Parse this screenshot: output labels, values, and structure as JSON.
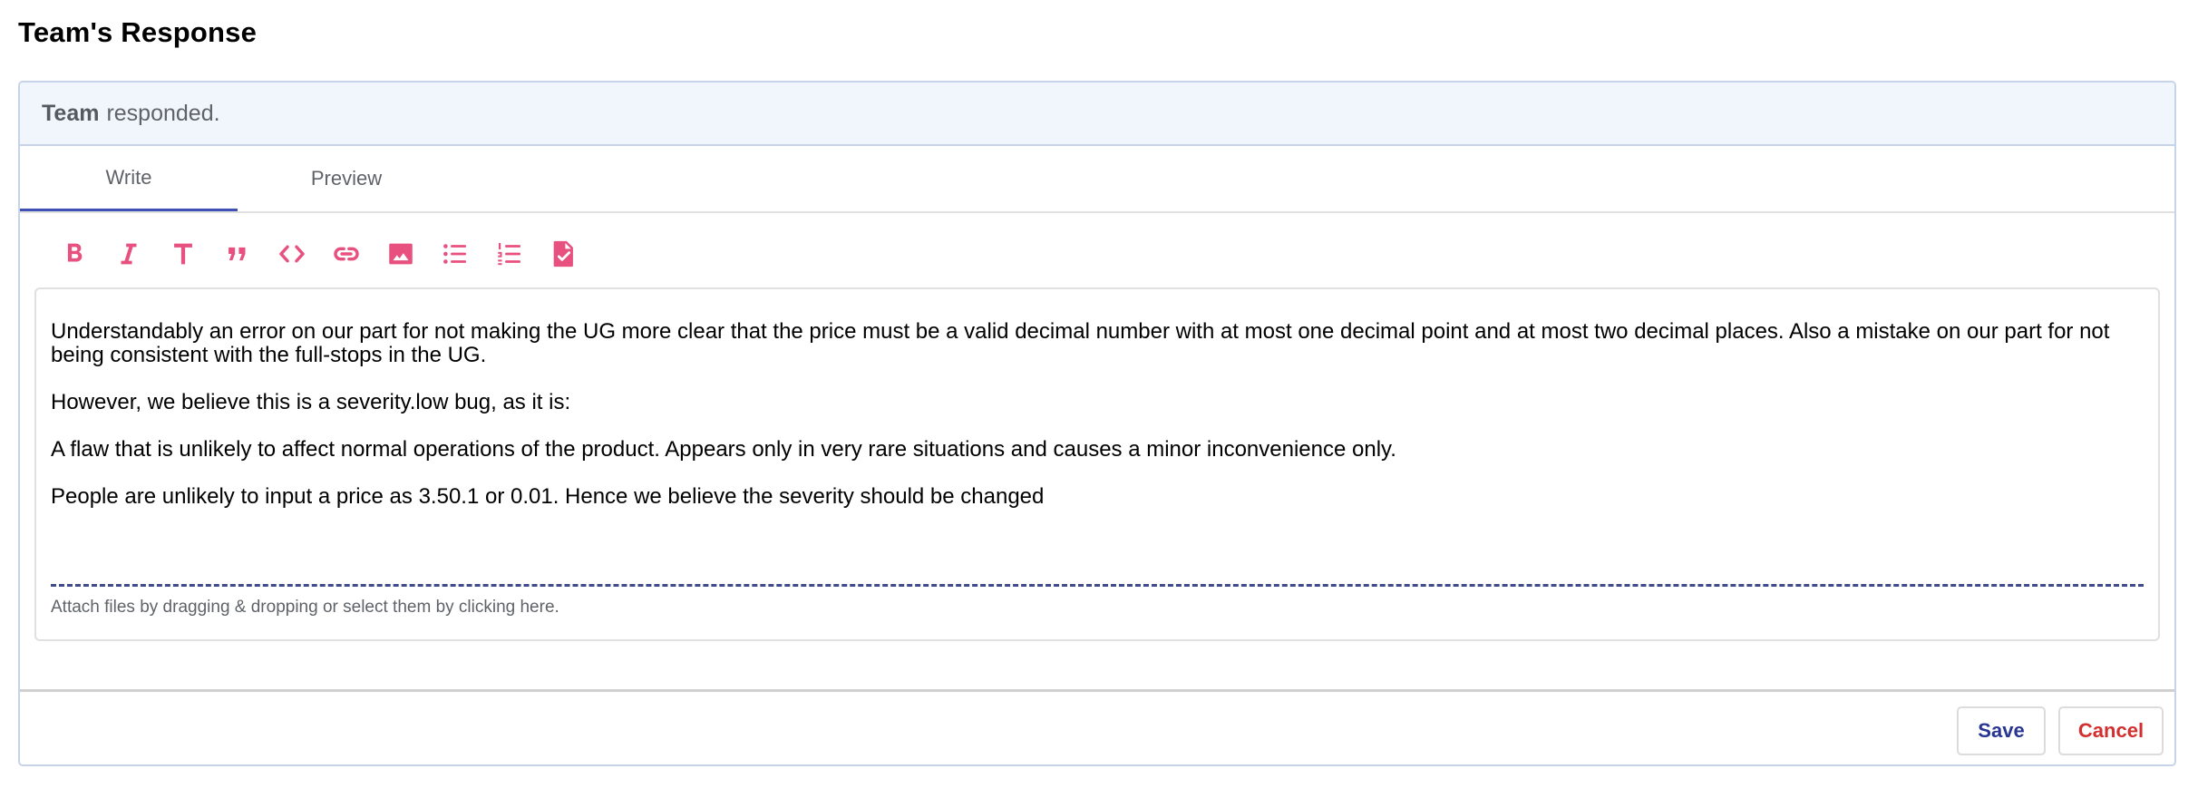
{
  "page": {
    "title": "Team's Response"
  },
  "comment": {
    "author": "Team",
    "action": "responded."
  },
  "tabs": [
    {
      "label": "Write",
      "active": true
    },
    {
      "label": "Preview",
      "active": false
    }
  ],
  "toolbar": {
    "icon_color": "#e8507f",
    "tools": [
      "bold-icon",
      "italic-icon",
      "heading-icon",
      "quote-icon",
      "code-icon",
      "link-icon",
      "image-icon",
      "bulleted-list-icon",
      "numbered-list-icon",
      "task-list-icon"
    ]
  },
  "editor": {
    "paragraphs": [
      "Understandably an error on our part for not making the UG more clear that the price must be a valid decimal number with at most one decimal point and at most two decimal places. Also a mistake on our part for not being consistent with the full-stops in the UG.",
      "However, we believe this is a severity.low bug, as it is:",
      "A flaw that is unlikely to affect normal operations of the product. Appears only in very rare situations and causes a minor inconvenience only.",
      "People are unlikely to input a price as 3.50.1 or 0.01. Hence we believe the severity should be changed"
    ],
    "attach_hint": "Attach files by dragging & dropping or select them by clicking here."
  },
  "actions": {
    "save_label": "Save",
    "cancel_label": "Cancel"
  }
}
